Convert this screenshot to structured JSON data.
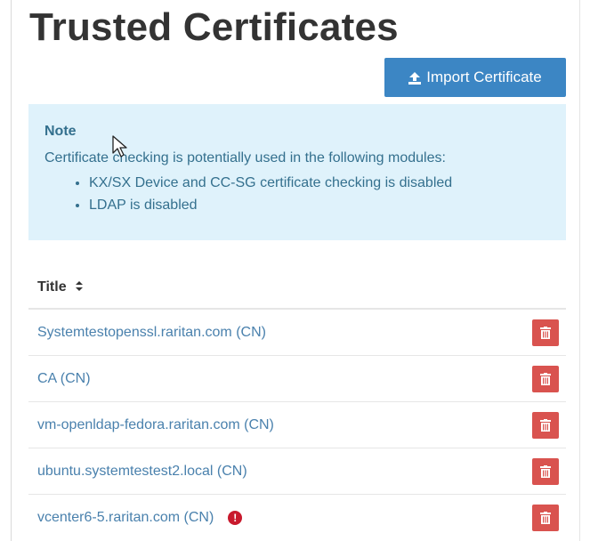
{
  "page": {
    "title": "Trusted Certificates",
    "import_button_label": "Import Certificate"
  },
  "note": {
    "title": "Note",
    "text": "Certificate checking is potentially used in the following modules:",
    "items": [
      "KX/SX Device and CC-SG certificate checking is disabled",
      "LDAP is disabled"
    ]
  },
  "table": {
    "column_title": "Title",
    "rows": [
      {
        "name": "Systemtestopenssl.raritan.com (CN)",
        "warning": false
      },
      {
        "name": "CA (CN)",
        "warning": false
      },
      {
        "name": "vm-openldap-fedora.raritan.com (CN)",
        "warning": false
      },
      {
        "name": "ubuntu.systemtestest2.local (CN)",
        "warning": false
      },
      {
        "name": "vcenter6-5.raritan.com (CN)",
        "warning": true
      }
    ]
  },
  "icons": {
    "import": "upload-icon",
    "sort": "sort-icon",
    "delete": "trash-icon",
    "warning": "exclamation-circle-icon"
  },
  "colors": {
    "primary_button": "#3c86c4",
    "note_background": "#dff2fb",
    "note_text": "#34708e",
    "link_text": "#4a81ad",
    "delete_button": "#d9534f",
    "warning": "#c8192d"
  }
}
